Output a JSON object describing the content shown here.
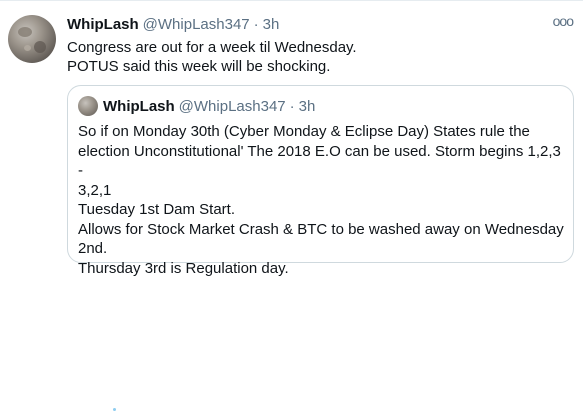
{
  "tweet": {
    "display_name": "WhipLash",
    "handle": "@WhipLash347",
    "separator": "·",
    "time": "3h",
    "more_icon": "more-horizontal-icon",
    "more_label": "ooo",
    "text_lines": [
      "Congress are out for a week til Wednesday.",
      "POTUS said this week will be shocking."
    ]
  },
  "quote": {
    "display_name": "WhipLash",
    "handle": "@WhipLash347",
    "separator": "·",
    "time": "3h",
    "text_lines": [
      "So if on Monday 30th (Cyber Monday & Eclipse Day) States rule the",
      "election Unconstitutional' The 2018 E.O can be used. Storm begins 1,2,3 -",
      "3,2,1",
      "Tuesday 1st Dam Start.",
      "Allows for Stock Market Crash & BTC to be washed away on Wednesday",
      "2nd.",
      "Thursday 3rd is Regulation day."
    ]
  },
  "colors": {
    "primary_text": "#0f1419",
    "secondary_text": "#5b7083",
    "border": "#cfd9de"
  }
}
